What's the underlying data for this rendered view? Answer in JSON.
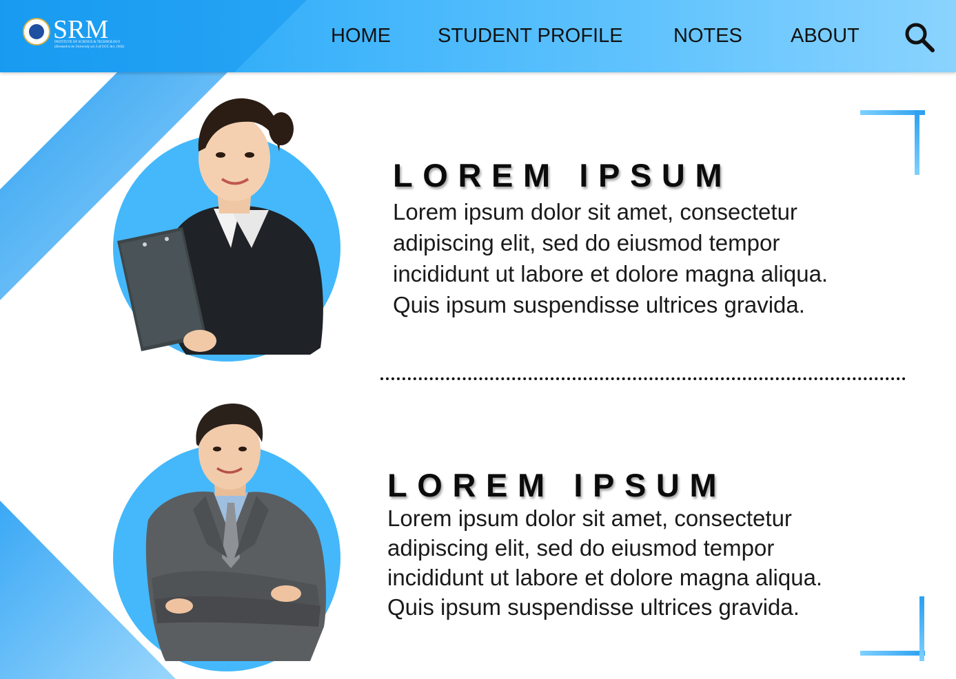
{
  "header": {
    "logo": {
      "name": "SRM",
      "subtitle": "INSTITUTE OF SCIENCE & TECHNOLOGY",
      "tagline": "(Deemed to be University u/s 3 of UGC Act, 1956)"
    },
    "nav": {
      "home": "HOME",
      "student_profile": "STUDENT PROFILE",
      "notes": "NOTES",
      "about": "ABOUT"
    },
    "search_icon": "search-icon"
  },
  "profiles": [
    {
      "title": "LOREM IPSUM",
      "description_lines": [
        "Lorem ipsum dolor sit amet, consectetur",
        "adipiscing elit, sed do eiusmod tempor",
        "incididunt ut labore et dolore magna aliqua.",
        "Quis ipsum suspendisse ultrices gravida."
      ],
      "photo": "woman-with-clipboard-photo"
    },
    {
      "title": "LOREM IPSUM",
      "description_lines": [
        "Lorem ipsum dolor sit amet, consectetur",
        "adipiscing elit, sed do eiusmod tempor",
        "incididunt ut labore et dolore magna aliqua.",
        "Quis ipsum suspendisse ultrices gravida."
      ],
      "photo": "man-in-suit-photo"
    }
  ],
  "colors": {
    "accent": "#44b8fb",
    "header_start": "#1aa0f3",
    "header_end": "#8ad3fe",
    "text": "#111111"
  }
}
